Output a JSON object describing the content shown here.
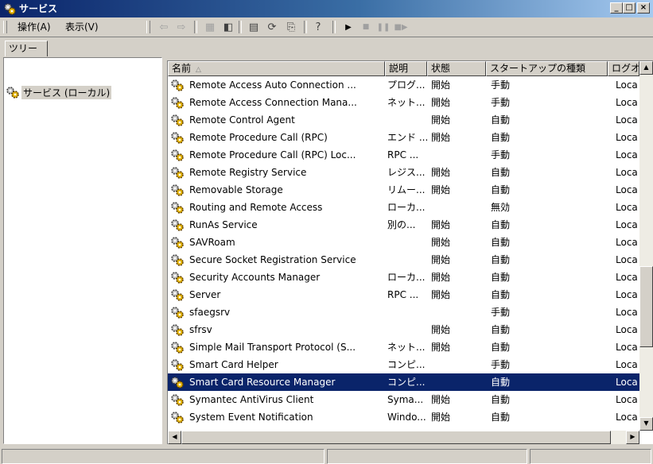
{
  "window": {
    "title": "サービス",
    "controls": {
      "minimize": "_",
      "maximize": "□",
      "close": "×"
    }
  },
  "menu": {
    "action_label": "操作(A)",
    "view_label": "表示(V)"
  },
  "toolbar": {
    "icons": [
      "back-icon",
      "forward-icon",
      "up-folder-icon",
      "show-tree-icon",
      "properties-icon",
      "refresh-icon",
      "export-list-icon",
      "help-icon",
      "start-service-icon",
      "stop-service-icon",
      "pause-service-icon",
      "restart-service-icon"
    ]
  },
  "tree": {
    "tab_label": "ツリー",
    "root_label": "サービス (ローカル)"
  },
  "list": {
    "columns": [
      {
        "label": "名前"
      },
      {
        "label": "説明"
      },
      {
        "label": "状態"
      },
      {
        "label": "スタートアップの種類"
      },
      {
        "label": "ログオ"
      }
    ],
    "rows": [
      {
        "name": "Remote Access Auto Connection ...",
        "desc": "プログ...",
        "status": "開始",
        "startup": "手動",
        "logon": "Loca"
      },
      {
        "name": "Remote Access Connection Mana...",
        "desc": "ネット...",
        "status": "開始",
        "startup": "手動",
        "logon": "Loca"
      },
      {
        "name": "Remote Control Agent",
        "desc": "",
        "status": "開始",
        "startup": "自動",
        "logon": "Loca"
      },
      {
        "name": "Remote Procedure Call (RPC)",
        "desc": "エンド ...",
        "status": "開始",
        "startup": "自動",
        "logon": "Loca"
      },
      {
        "name": "Remote Procedure Call (RPC) Loc...",
        "desc": "RPC ...",
        "status": "",
        "startup": "手動",
        "logon": "Loca"
      },
      {
        "name": "Remote Registry Service",
        "desc": "レジス...",
        "status": "開始",
        "startup": "自動",
        "logon": "Loca"
      },
      {
        "name": "Removable Storage",
        "desc": "リムー...",
        "status": "開始",
        "startup": "自動",
        "logon": "Loca"
      },
      {
        "name": "Routing and Remote Access",
        "desc": "ローカ...",
        "status": "",
        "startup": "無効",
        "logon": "Loca"
      },
      {
        "name": "RunAs Service",
        "desc": "別の...",
        "status": "開始",
        "startup": "自動",
        "logon": "Loca"
      },
      {
        "name": "SAVRoam",
        "desc": "",
        "status": "開始",
        "startup": "自動",
        "logon": "Loca"
      },
      {
        "name": "Secure Socket Registration Service",
        "desc": "",
        "status": "開始",
        "startup": "自動",
        "logon": "Loca"
      },
      {
        "name": "Security Accounts Manager",
        "desc": "ローカ...",
        "status": "開始",
        "startup": "自動",
        "logon": "Loca"
      },
      {
        "name": "Server",
        "desc": "RPC ...",
        "status": "開始",
        "startup": "自動",
        "logon": "Loca"
      },
      {
        "name": "sfaegsrv",
        "desc": "",
        "status": "",
        "startup": "手動",
        "logon": "Loca"
      },
      {
        "name": "sfrsv",
        "desc": "",
        "status": "開始",
        "startup": "自動",
        "logon": "Loca"
      },
      {
        "name": "Simple Mail Transport Protocol (S...",
        "desc": "ネット...",
        "status": "開始",
        "startup": "自動",
        "logon": "Loca"
      },
      {
        "name": "Smart Card Helper",
        "desc": "コンピ...",
        "status": "",
        "startup": "手動",
        "logon": "Loca"
      },
      {
        "name": "Smart Card Resource Manager",
        "desc": "コンピ...",
        "status": "",
        "startup": "自動",
        "logon": "Loca",
        "selected": true
      },
      {
        "name": "Symantec AntiVirus Client",
        "desc": "Syma...",
        "status": "開始",
        "startup": "自動",
        "logon": "Loca"
      },
      {
        "name": "System Event Notification",
        "desc": "Windo...",
        "status": "開始",
        "startup": "自動",
        "logon": "Loca"
      }
    ]
  },
  "status_bar": {
    "panels": [
      "",
      "",
      ""
    ]
  },
  "colors": {
    "selection": "#0a246a",
    "title_start": "#0a246a",
    "title_end": "#a6caf0",
    "face": "#d4d0c8"
  }
}
